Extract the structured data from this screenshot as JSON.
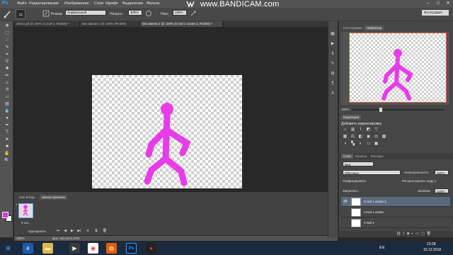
{
  "colors": {
    "foreground": "#e333e3",
    "background": "#ffffff",
    "figure": "#e83ce8",
    "navigator_frame": "#e05a3a"
  },
  "app": {
    "logo": "Ps",
    "watermark": "www.BANDICAM.com",
    "menus": [
      "Файл",
      "Редактирование",
      "Изображение",
      "Слои",
      "Шрифт",
      "Выделение",
      "Фильтр"
    ]
  },
  "options": {
    "brush_size": "21",
    "mode_label": "Режим:",
    "mode_value": "Нормальный",
    "opacity_label": "Непроз.:",
    "opacity_value": "100%",
    "flow_label": "Наж.:",
    "flow_value": "100%",
    "workspace": "Фотография"
  },
  "tabs": [
    {
      "label": "chevo.gif @ 100% (Слой 2, RGB/8) *",
      "active": false
    },
    {
      "label": "Без имени 1 @ 100% (RGB/8)",
      "active": false
    },
    {
      "label": "Без имени 2 @ 100% (Слой 1 копия 2, RGB/8) *",
      "active": true
    }
  ],
  "timeline": {
    "tabs": [
      {
        "label": "Mini Bridge",
        "active": false
      },
      {
        "label": "Шкала времени",
        "active": true
      }
    ],
    "frame_delay": "5 сек.",
    "loop": "Однократно",
    "frame_number": "1"
  },
  "status": {
    "zoom": "100%",
    "doc": "Док: 452,2K/1,07M"
  },
  "panels": {
    "nav_tabs": [
      {
        "label": "Гистограмма",
        "active": false
      },
      {
        "label": "Навигатор",
        "active": true
      }
    ],
    "nav_zoom": "100%",
    "correction_tab": "Коррекция",
    "adj_title": "Добавить корректировку",
    "layer_tabs": [
      {
        "label": "Слои",
        "active": true
      },
      {
        "label": "Каналы",
        "active": false
      },
      {
        "label": "Контуры",
        "active": false
      }
    ],
    "layer_kind": "Вид",
    "blend_mode": "Обычные",
    "opacity_label": "Непрозрачность:",
    "opacity_value": "100%",
    "unify_label": "Унифицировать:",
    "propagate_label": "Распространить кадр 1",
    "lock_label": "Закрепить:",
    "fill_label": "Заливка:",
    "fill_value": "100%",
    "layers": [
      {
        "name": "Слой 1 копия 2",
        "visible": true,
        "active": true
      },
      {
        "name": "Слой 1 копия",
        "visible": false,
        "active": false
      },
      {
        "name": "Слой 1",
        "visible": false,
        "active": false
      }
    ]
  },
  "taskbar": {
    "lang": "EN",
    "time": "23:28",
    "date": "15.12.2018"
  }
}
